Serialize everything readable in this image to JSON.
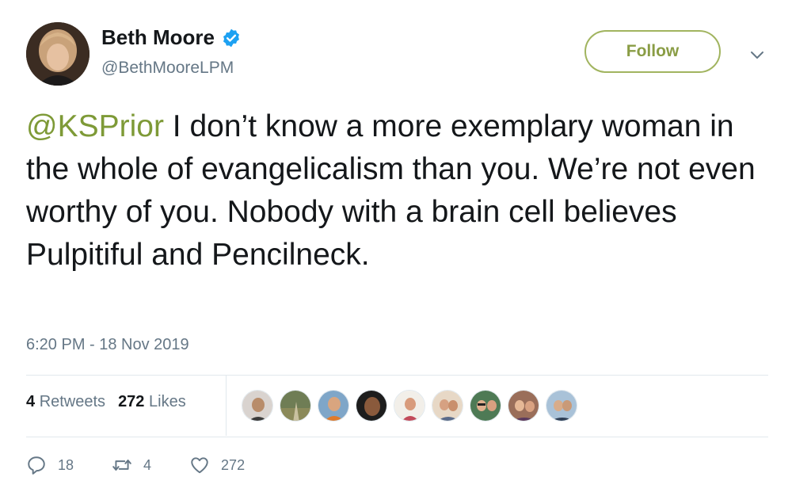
{
  "tweet": {
    "author": {
      "display_name": "Beth Moore",
      "handle": "@BethMooreLPM",
      "verified_icon": "verified-badge-icon",
      "avatar_icon": "avatar"
    },
    "follow_label": "Follow",
    "mention": "@KSPrior",
    "body": " I don’t know a more exemplary woman in the whole of evangelicalism than you. We’re not even worthy of you. Nobody with a brain cell believes Pulpitiful and Pencilneck.",
    "timestamp": "6:20 PM - 18 Nov 2019",
    "stats": {
      "retweets_count": "4",
      "retweets_label": "Retweets",
      "likes_count": "272",
      "likes_label": "Likes"
    },
    "actions": {
      "replies": "18",
      "retweets": "4",
      "likes": "272"
    }
  },
  "colors": {
    "accent": "#8a9d45",
    "mention": "#7e9a37",
    "verified": "#1da1f2",
    "secondary_text": "#657786",
    "divider": "#e1e8ed"
  }
}
